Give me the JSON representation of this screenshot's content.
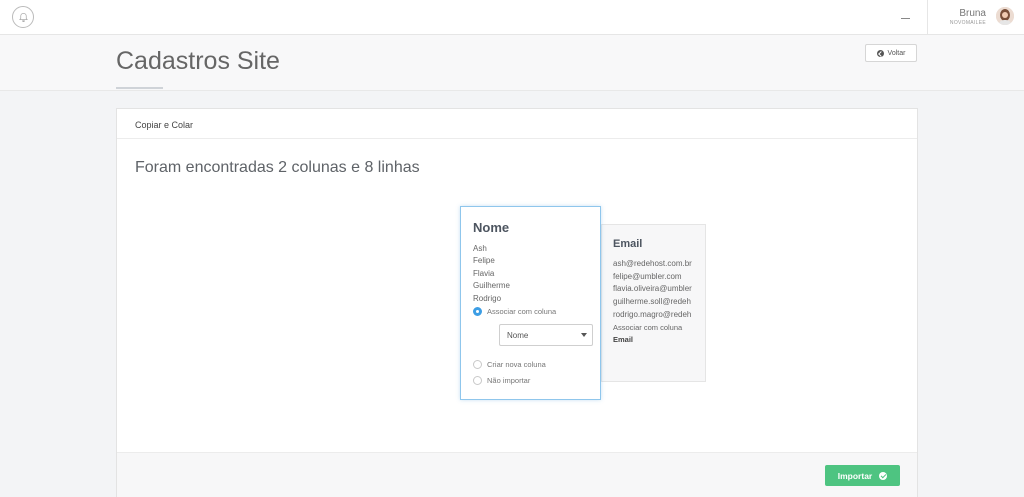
{
  "topbar": {
    "user_name": "Bruna",
    "user_subtitle": "NOVOMAILEE"
  },
  "header": {
    "title": "Cadastros Site",
    "back_label": "Voltar"
  },
  "panel": {
    "title": "Copiar e Colar",
    "found_text": "Foram encontradas 2 colunas e 8 linhas"
  },
  "columns": [
    {
      "title": "Nome",
      "values": [
        "Ash",
        "Felipe",
        "Flavia",
        "Guilherme",
        "Rodrigo"
      ],
      "options": {
        "associate_label": "Associar com coluna",
        "selected_column": "Nome",
        "new_column_label": "Criar nova coluna",
        "skip_label": "Não importar",
        "selected_option": "associate"
      }
    },
    {
      "title": "Email",
      "values": [
        "ash@redehost.com.br",
        "felipe@umbler.com",
        "flavia.oliveira@umbler",
        "guilherme.soll@redeh",
        "rodrigo.magro@redeh"
      ],
      "associate_label": "Associar com coluna",
      "associated_column": "Email"
    }
  ],
  "footer": {
    "import_label": "Importar"
  },
  "colors": {
    "accent_blue": "#3d9ee5",
    "import_green": "#4ec481"
  }
}
